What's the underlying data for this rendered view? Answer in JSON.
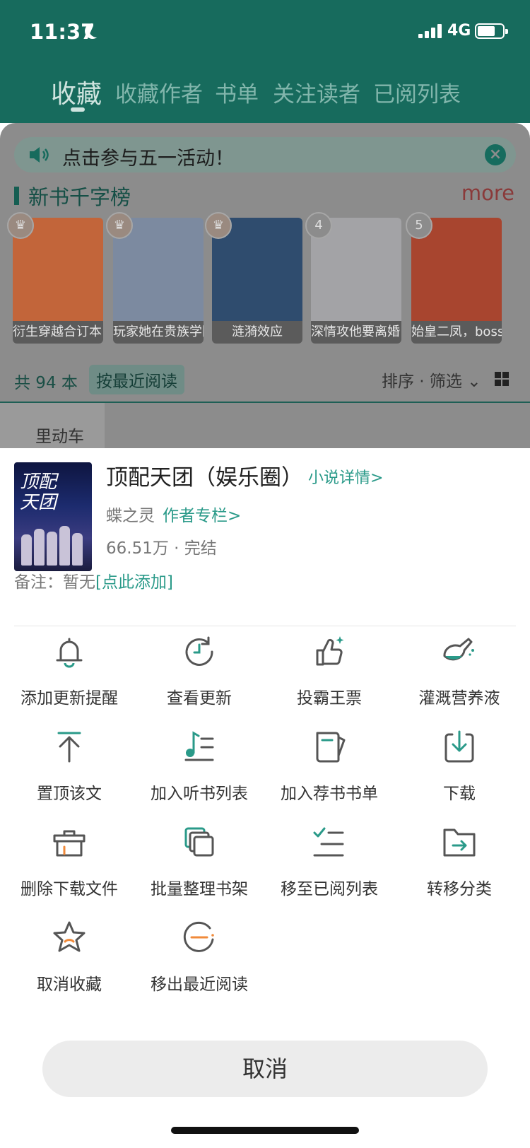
{
  "status_bar": {
    "time": "11:37",
    "network": "4G"
  },
  "tabs": [
    {
      "label": "收藏",
      "active": true
    },
    {
      "label": "收藏作者",
      "active": false
    },
    {
      "label": "书单",
      "active": false
    },
    {
      "label": "关注读者",
      "active": false
    },
    {
      "label": "已阅列表",
      "active": false
    }
  ],
  "banner": {
    "text": "点击参与五一活动！"
  },
  "ranking": {
    "title": "新书千字榜",
    "more": "more",
    "books": [
      {
        "caption": "衍生穿越合订本",
        "badge": "",
        "color": "#c2653a"
      },
      {
        "caption": "玩家她在贵族学院捡垃圾",
        "badge": "",
        "color": "#7c8aa0"
      },
      {
        "caption": "涟漪效应",
        "badge": "",
        "color": "#2f4c6e"
      },
      {
        "caption": "深情攻他要离婚",
        "badge": "4",
        "color": "#a3a3a6"
      },
      {
        "caption": "始皇二凤，boss直聘",
        "badge": "5",
        "color": "#a8452f"
      }
    ]
  },
  "shelf": {
    "count": "共 94 本",
    "recent_tag": "按最近阅读",
    "sort": "排序 · 筛选",
    "partial_title": "里动车"
  },
  "sheet": {
    "book_title": "顶配天团（娱乐圈）",
    "detail_link": "小说详情>",
    "author": "蝶之灵",
    "author_link": "作者专栏>",
    "meta": "66.51万 · 完结",
    "note_prefix": "备注：暂无",
    "note_link": "[点此添加]",
    "cover_title": "顶配天团"
  },
  "actions": [
    {
      "label": "添加更新提醒",
      "icon": "bell-icon"
    },
    {
      "label": "查看更新",
      "icon": "refresh-clock-icon"
    },
    {
      "label": "投霸王票",
      "icon": "thumbs-up-icon"
    },
    {
      "label": "灌溉营养液",
      "icon": "flask-icon"
    },
    {
      "label": "置顶该文",
      "icon": "pin-top-icon"
    },
    {
      "label": "加入听书列表",
      "icon": "audio-list-icon"
    },
    {
      "label": "加入荐书书单",
      "icon": "book-list-icon"
    },
    {
      "label": "下载",
      "icon": "download-icon"
    },
    {
      "label": "删除下载文件",
      "icon": "delete-files-icon"
    },
    {
      "label": "批量整理书架",
      "icon": "batch-shelf-icon"
    },
    {
      "label": "移至已阅列表",
      "icon": "read-list-icon"
    },
    {
      "label": "转移分类",
      "icon": "move-folder-icon"
    },
    {
      "label": "取消收藏",
      "icon": "unfavorite-star-icon"
    },
    {
      "label": "移出最近阅读",
      "icon": "remove-recent-icon"
    }
  ],
  "cancel_label": "取消",
  "colors": {
    "accent": "#2a9a89",
    "orange": "#f08a3a",
    "header": "#176b5d"
  }
}
